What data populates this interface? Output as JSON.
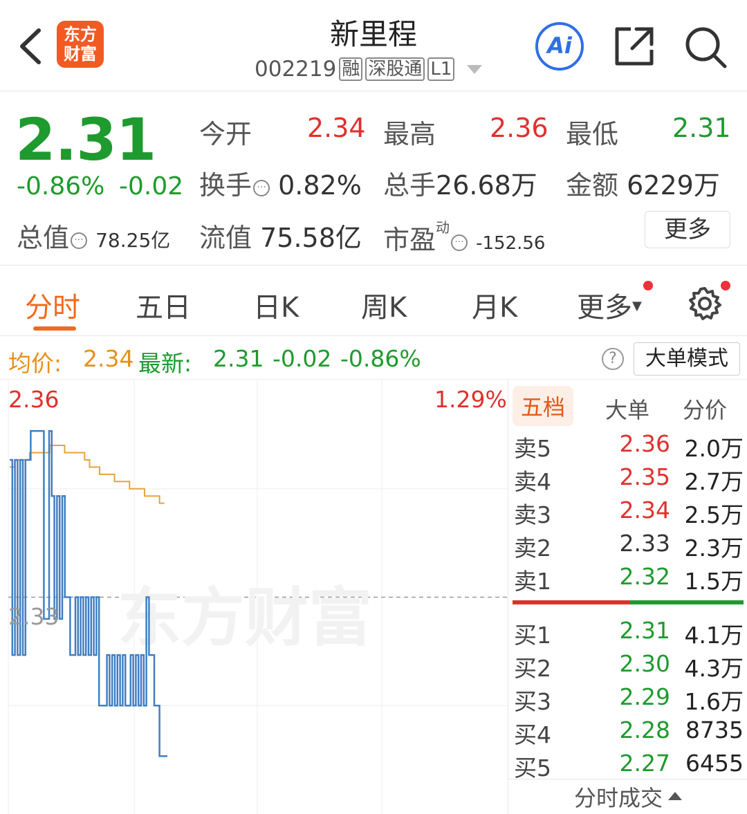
{
  "header": {
    "title": "新里程",
    "code": "002219",
    "tags": [
      "融",
      "深股通",
      "L1"
    ],
    "logo_lines": [
      "东方",
      "财富"
    ],
    "ai_label": "Ai"
  },
  "quote": {
    "price": "2.31",
    "change_pct": "-0.86%",
    "change": "-0.02",
    "open_label": "今开",
    "open": "2.34",
    "high_label": "最高",
    "high": "2.36",
    "low_label": "最低",
    "low": "2.31",
    "turnover_label": "换手",
    "turnover": "0.82%",
    "volume_label": "总手",
    "volume": "26.68万",
    "amount_label": "金额",
    "amount": "6229万",
    "mktcap_label": "总值",
    "mktcap": "78.25亿",
    "float_label": "流值",
    "float": "75.58亿",
    "pe_label": "市盈",
    "pe_sup": "动",
    "pe": "-152.56",
    "more_label": "更多"
  },
  "tabs": [
    {
      "label": "分时"
    },
    {
      "label": "五日"
    },
    {
      "label": "日K"
    },
    {
      "label": "周K"
    },
    {
      "label": "月K"
    },
    {
      "label": "更多"
    }
  ],
  "infobar": {
    "avg_label": "均价:",
    "avg": "2.34",
    "last_label": "最新:",
    "last": "2.31",
    "chg": "-0.02",
    "chg_pct": "-0.86%",
    "mode_label": "大单模式"
  },
  "chart": {
    "top_price": "2.36",
    "top_pct": "1.29%",
    "mid_price": "2.33",
    "watermark": "东方财富",
    "colors": {
      "price": "#3f7fc3",
      "avg": "#e6a23c",
      "ref": "#9a9a9a"
    }
  },
  "chart_data": {
    "type": "line",
    "ylim": [
      2.3,
      2.36
    ],
    "reference": 2.33,
    "series": [
      {
        "values": [
          2.349,
          2.322,
          2.349,
          2.322,
          2.349,
          2.322,
          2.349,
          2.349,
          2.353,
          2.353,
          2.353,
          2.353,
          2.353,
          2.327,
          2.327,
          2.353,
          2.344,
          2.327,
          2.344,
          2.327,
          2.344,
          2.33,
          2.33,
          2.322,
          2.322,
          2.33,
          2.322,
          2.33,
          2.322,
          2.33,
          2.322,
          2.33,
          2.322,
          2.33,
          2.315,
          2.315,
          2.315,
          2.322,
          2.315,
          2.322,
          2.315,
          2.322,
          2.315,
          2.322,
          2.315,
          2.315,
          2.322,
          2.315,
          2.322,
          2.315,
          2.322,
          2.315,
          2.33,
          2.322,
          2.322,
          2.315,
          2.315,
          2.308,
          2.308,
          2.308,
          2.308
        ]
      },
      {
        "values": [
          2.348,
          2.349,
          2.349,
          2.349,
          2.35,
          2.35,
          2.35,
          2.35,
          2.351,
          2.351,
          2.351,
          2.35,
          2.35,
          2.35,
          2.35,
          2.349,
          2.348,
          2.348,
          2.347,
          2.347,
          2.347,
          2.346,
          2.346,
          2.346,
          2.345,
          2.345,
          2.345,
          2.344,
          2.344,
          2.344,
          2.343,
          2.343
        ]
      }
    ]
  },
  "book": {
    "tabs": [
      "五档",
      "大单",
      "分价"
    ],
    "asks": [
      {
        "label": "卖5",
        "price": "2.36",
        "vol": "2.0万",
        "color": "red"
      },
      {
        "label": "卖4",
        "price": "2.35",
        "vol": "2.7万",
        "color": "red"
      },
      {
        "label": "卖3",
        "price": "2.34",
        "vol": "2.5万",
        "color": "red"
      },
      {
        "label": "卖2",
        "price": "2.33",
        "vol": "2.3万",
        "color": "dark"
      },
      {
        "label": "卖1",
        "price": "2.32",
        "vol": "1.5万",
        "color": "green"
      }
    ],
    "bids": [
      {
        "label": "买1",
        "price": "2.31",
        "vol": "4.1万",
        "color": "green"
      },
      {
        "label": "买2",
        "price": "2.30",
        "vol": "4.3万",
        "color": "green"
      },
      {
        "label": "买3",
        "price": "2.29",
        "vol": "1.6万",
        "color": "green"
      },
      {
        "label": "买4",
        "price": "2.28",
        "vol": "8735",
        "color": "green"
      },
      {
        "label": "买5",
        "price": "2.27",
        "vol": "6455",
        "color": "green"
      }
    ],
    "footer_label": "分时成交"
  }
}
